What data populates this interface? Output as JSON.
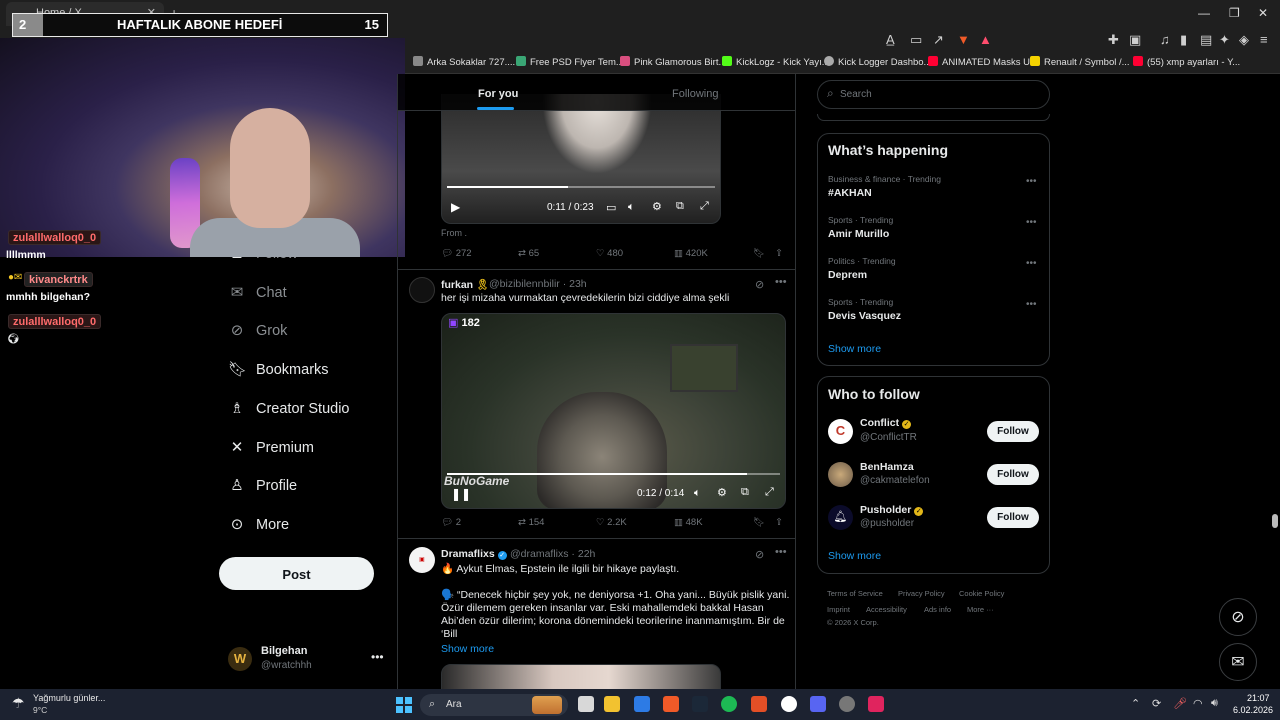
{
  "browser": {
    "tab_title": "Home / X",
    "bookmarks": [
      "Arka Sokaklar 727....",
      "Free PSD Flyer Tem...",
      "Pink Glamorous Birt...",
      "KickLogz - Kick Yayı...",
      "Kick Logger Dashbo...",
      "ANIMATED Masks U...",
      "Renault / Symbol /...",
      "(55) xmp ayarları - Y..."
    ]
  },
  "overlay": {
    "left_number": "2",
    "title": "HAFTALIK ABONE HEDEFİ",
    "count": "15"
  },
  "stream_chat": [
    {
      "user": "zulalllwalloq0_0",
      "message": "llllmmm"
    },
    {
      "user": "kivanckrtrk",
      "message": "mmhh bilgehan?"
    },
    {
      "user": "zulalllwalloq0_0",
      "message": ""
    }
  ],
  "nav": {
    "items": [
      "Follow",
      "Chat",
      "Grok",
      "Bookmarks",
      "Creator Studio",
      "Premium",
      "Profile",
      "More"
    ],
    "post_label": "Post"
  },
  "account": {
    "name": "Bilgehan",
    "handle": "@wratchhh",
    "avatar_letter": "W"
  },
  "timeline": {
    "tabs": [
      "For you",
      "Following"
    ],
    "tweet1": {
      "video_time": "0:11 / 0:23",
      "progress": 0.45,
      "from": "From .",
      "replies": "272",
      "reposts": "65",
      "likes": "480",
      "views": "420K"
    },
    "tweet2": {
      "name": "furkan",
      "handle": "@bizibilennbilir",
      "time": "23h",
      "text": "her işi mizaha vurmaktan çevredekilerin bizi ciddiye alma şekli",
      "overlay_count": "182",
      "watermark": "BuNoGame",
      "video_time": "0:12 / 0:14",
      "progress": 0.9,
      "replies": "2",
      "reposts": "154",
      "likes": "2.2K",
      "views": "48K"
    },
    "tweet3": {
      "name": "Dramaflixs",
      "handle": "@dramaflixs",
      "time": "22h",
      "line1": "🔥 Aykut Elmas, Epstein ile ilgili bir hikaye paylaştı.",
      "line2": "🗣️ “Denecek hiçbir şey yok, ne deniyorsa +1. Oha yani... Büyük pislik yani.",
      "line3": "Özür dilemem gereken insanlar var. Eski mahallemdeki bakkal Hasan",
      "line4": "Abi’den özür dilerim; korona dönemindeki teorilerine inanmamıştım. Bir de",
      "line5": "‘Bill",
      "show_more": "Show more"
    }
  },
  "sidebar": {
    "search_placeholder": "Search",
    "happening_title": "What’s happening",
    "trends": [
      {
        "category": "Business & finance · Trending",
        "name": "#AKHAN"
      },
      {
        "category": "Sports · Trending",
        "name": "Amir Murillo"
      },
      {
        "category": "Politics · Trending",
        "name": "Deprem"
      },
      {
        "category": "Sports · Trending",
        "name": "Devis Vasquez"
      }
    ],
    "show_more": "Show more",
    "wtf_title": "Who to follow",
    "who_to_follow": [
      {
        "name": "Conflict",
        "handle": "@ConflictTR",
        "button": "Follow"
      },
      {
        "name": "BenHamza",
        "handle": "@cakmatelefon",
        "button": "Follow"
      },
      {
        "name": "Pusholder",
        "handle": "@pusholder",
        "button": "Follow"
      }
    ],
    "wtf_show_more": "Show more",
    "footer": [
      "Terms of Service",
      "Privacy Policy",
      "Cookie Policy",
      "Imprint",
      "Accessibility",
      "Ads info",
      "More ···",
      "© 2026 X Corp."
    ]
  },
  "taskbar": {
    "weather_title": "Yağmurlu günler...",
    "weather_temp": "9°C",
    "search_text": "Ara",
    "time": "21:07",
    "date": "6.02.2026"
  },
  "colors": {
    "accent": "#1d9bf0",
    "background": "#000000",
    "border": "#2f3336",
    "muted": "#71767b"
  }
}
